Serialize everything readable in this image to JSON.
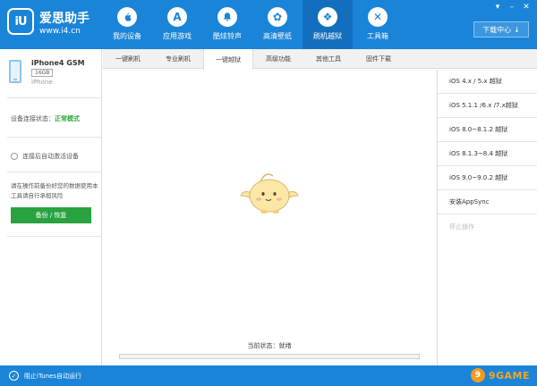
{
  "app": {
    "logo_text": "iU",
    "brand": "爱思助手",
    "url": "www.i4.cn"
  },
  "nav": [
    {
      "label": "我的设备",
      "icon": "apple-icon",
      "glyph": ""
    },
    {
      "label": "应用游戏",
      "icon": "app-store-icon",
      "glyph": "A"
    },
    {
      "label": "酷炫铃声",
      "icon": "bell-icon",
      "glyph": "♪"
    },
    {
      "label": "高清壁纸",
      "icon": "flower-icon",
      "glyph": "✿"
    },
    {
      "label": "刷机越狱",
      "icon": "dropbox-icon",
      "glyph": "❖"
    },
    {
      "label": "工具箱",
      "icon": "toolbox-icon",
      "glyph": "✕"
    }
  ],
  "window": {
    "download_label": "下载中心",
    "download_arrow": "↓"
  },
  "device": {
    "name": "iPhone4 GSM",
    "capacity": "16GB",
    "model": "iPhone",
    "status_prefix": "设备连接状态：",
    "status_value": "正常模式",
    "auto_activate": "连接后自动激活设备",
    "warning": "请在操作前备份好您的数据使用本工具请自行承担风险",
    "backup_button": "备份 / 恢复"
  },
  "tabs": [
    {
      "label": "一键刷机"
    },
    {
      "label": "专业刷机"
    },
    {
      "label": "一键越狱"
    },
    {
      "label": "高级功能"
    },
    {
      "label": "其他工具"
    },
    {
      "label": "固件下载"
    }
  ],
  "active_tab": "一键越狱",
  "main": {
    "status_label": "当前状态：",
    "status_value": "就绪",
    "progress": 0
  },
  "jailbreak_options": [
    {
      "label": "iOS 4.x / 5.x 越狱",
      "enabled": true
    },
    {
      "label": "iOS 5.1.1 /6.x /7.x越狱",
      "enabled": true
    },
    {
      "label": "iOS 8.0~8.1.2 越狱",
      "enabled": true
    },
    {
      "label": "iOS 8.1.3~8.4 越狱",
      "enabled": true
    },
    {
      "label": "iOS 9.0~9.0.2 越狱",
      "enabled": true
    },
    {
      "label": "安装AppSync",
      "enabled": true
    },
    {
      "label": "停止操作",
      "enabled": false
    }
  ],
  "footer": {
    "check_text": "阻止iTunes自动运行",
    "watermark": "9GAME"
  },
  "colors": {
    "primary": "#1a84d8",
    "active_nav": "#136fbd",
    "success": "#2ca53a",
    "button_green": "#29a340"
  }
}
